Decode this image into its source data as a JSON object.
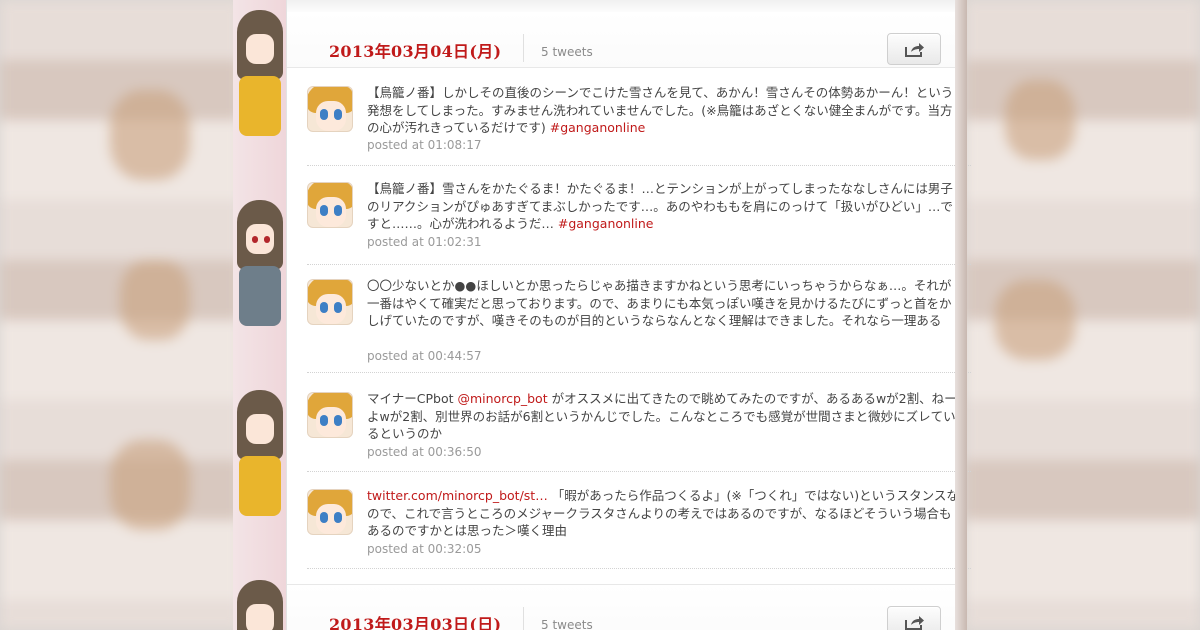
{
  "days": [
    {
      "date": "2013年03月04日(月)",
      "count": "5 tweets",
      "tweets": [
        {
          "parts": [
            "【鳥籠ノ番】しかしその直後のシーンでこけた雪さんを見て、あかん！雪さんその体勢あかーん！という発想をしてしまった。すみません洗われていませんでした。(※鳥籠はあざとくない健全まんがです。当方の心が汚れきっているだけです) ",
            ""
          ],
          "tag": "#ganganonline",
          "posted": "posted at 01:08:17"
        },
        {
          "parts": [
            "【鳥籠ノ番】雪さんをかたぐるま！かたぐるま！…とテンションが上がってしまったななしさんには男子のリアクションがぴゅあすぎてまぶしかったです…。あのやわももを肩にのっけて「扱いがひどい」…ですと……。心が洗われるようだ… ",
            ""
          ],
          "tag": "#ganganonline",
          "posted": "posted at 01:02:31"
        },
        {
          "parts": [
            "〇〇少ないとか●●ほしいとか思ったらじゃあ描きますかねという思考にいっちゃうからなぁ…。それが一番はやくて確実だと思っております。ので、あまりにも本気っぽい嘆きを見かけるたびにずっと首をかしげていたのですが、嘆きそのものが目的というならなんとなく理解はできました。それなら一理ある",
            ""
          ],
          "tag": "",
          "posted": "posted at 00:44:57"
        },
        {
          "parts": [
            "マイナーCPbot ",
            " がオススメに出てきたので眺めてみたのですが、あるあるwが2割、ねーよwが2割、別世界のお話が6割というかんじでした。こんなところでも感覚が世間さまと微妙にズレているというのか"
          ],
          "mention": "@minorcp_bot",
          "posted": "posted at 00:36:50"
        },
        {
          "link": "twitter.com/minorcp_bot/st…",
          "parts": [
            " 「暇があったら作品つくるよ」(※「つくれ」ではない)というスタンスなので、これで言うところのメジャークラスタさんよりの考えではあるのですが、なるほどそういう場合もあるのですかとは思った＞嘆く理由",
            ""
          ],
          "posted": "posted at 00:32:05"
        }
      ]
    },
    {
      "date": "2013年03月03日(日)",
      "count": "5 tweets"
    }
  ],
  "colors": {
    "accent": "#c01a1a",
    "meta": "#9a9a9a",
    "text": "#444444"
  },
  "icons": {
    "share": "share-icon"
  }
}
